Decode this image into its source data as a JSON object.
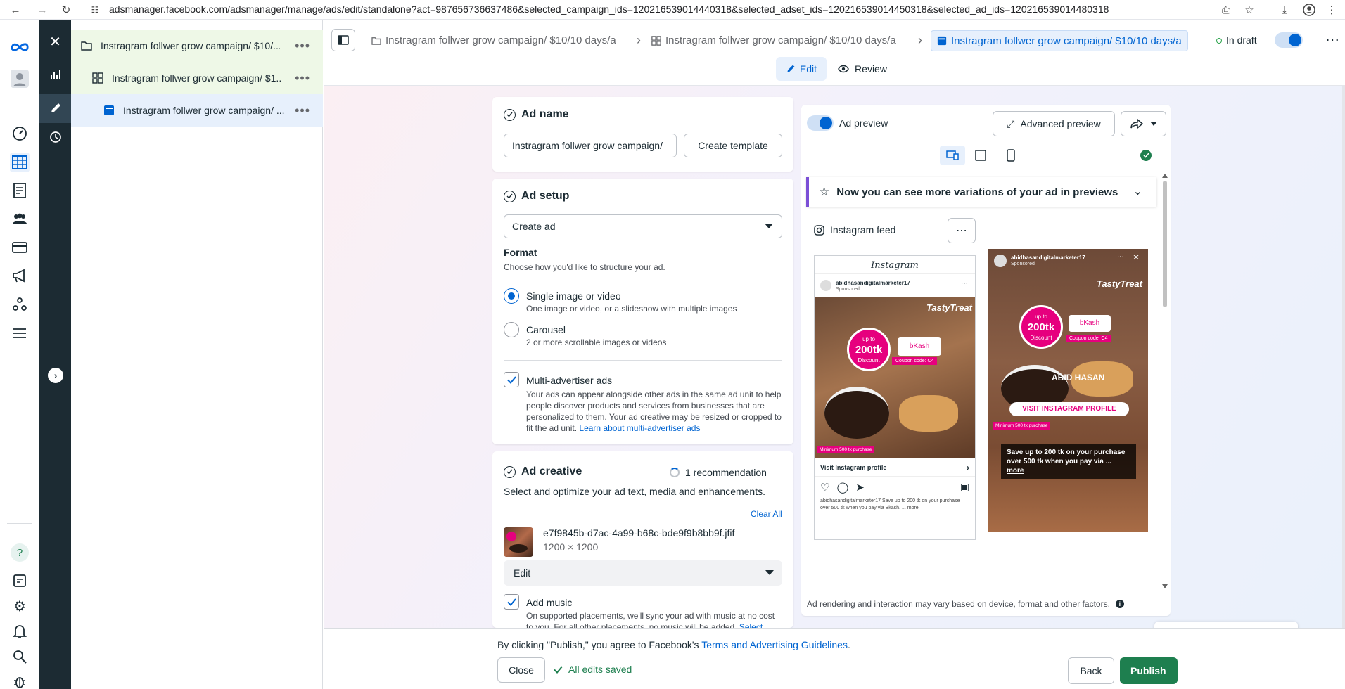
{
  "browser": {
    "url": "adsmanager.facebook.com/adsmanager/manage/ads/edit/standalone?act=987656736637486&selected_campaign_ids=120216539014440318&selected_adset_ids=120216539014450318&selected_ad_ids=120216539014480318"
  },
  "tree": {
    "campaign": "Instragram follwer grow campaign/ $10/...",
    "adset": "Instragram follwer grow campaign/ $1...",
    "ad": "Instragram follwer grow campaign/ ..."
  },
  "header": {
    "crumb_campaign": "Instragram follwer grow campaign/ $10/10 days/a",
    "crumb_adset": "Instragram follwer grow campaign/ $10/10 days/a",
    "crumb_ad": "Instragram follwer grow campaign/ $10/10 days/a",
    "status": "In draft",
    "tab_edit": "Edit",
    "tab_review": "Review"
  },
  "ad_name": {
    "title": "Ad name",
    "value": "Instragram follwer grow campaign/",
    "create_template": "Create template"
  },
  "ad_setup": {
    "title": "Ad setup",
    "select_value": "Create ad",
    "format_title": "Format",
    "format_desc": "Choose how you'd like to structure your ad.",
    "opt1_label": "Single image or video",
    "opt1_desc": "One image or video, or a slideshow with multiple images",
    "opt2_label": "Carousel",
    "opt2_desc": "2 or more scrollable images or videos",
    "multi_label": "Multi-advertiser ads",
    "multi_desc": "Your ads can appear alongside other ads in the same ad unit to help people discover products and services from businesses that are personalized to them. Your ad creative may be resized or cropped to fit the ad unit.",
    "multi_link": "Learn about multi-advertiser ads"
  },
  "ad_creative": {
    "title": "Ad creative",
    "recommendation": "1 recommendation",
    "desc": "Select and optimize your ad text, media and enhancements.",
    "clear_all": "Clear All",
    "file_name": "e7f9845b-d7ac-4a99-b68c-bde9f9b8bb9f.jfif",
    "file_size": "1200 × 1200",
    "edit_select": "Edit",
    "music_label": "Add music",
    "music_desc": "On supported placements, we'll sync your ad with music at no cost to you. For all other placements, no music will be added.",
    "music_link": "Select"
  },
  "preview": {
    "toggle_label": "Ad preview",
    "advanced": "Advanced preview",
    "banner": "Now you can see more variations of your ad in previews",
    "placement": "Instagram feed",
    "ig_brand": "Instagram",
    "account": "abidhasandigitalmarketer17",
    "sponsored": "Sponsored",
    "brand": "TastyTreat",
    "offer_top": "up to",
    "offer_amount": "200tk",
    "offer_bottom": "Discount",
    "pay": "bKash",
    "coupon": "Coupon code: C4",
    "minimum": "Minimum 500 tk purchase",
    "cta": "Visit Instagram profile",
    "caption": "abidhasandigitalmarketer17 Save up to 200 tk on your purchase over 500 tk when you pay via Bkash. ... more",
    "story_name": "ABID HASAN",
    "story_cta": "VISIT INSTAGRAM PROFILE",
    "story_caption": "Save up to 200 tk on your purchase over 500 tk when you pay via ...",
    "story_more": "more",
    "disclaimer": "Ad rendering and interaction may vary based on device, format and other factors."
  },
  "footer": {
    "terms_prefix": "By clicking \"Publish,\" you agree to Facebook's",
    "terms_link": "Terms and Advertising Guidelines",
    "close": "Close",
    "saved": "All edits saved",
    "back": "Back",
    "publish": "Publish"
  },
  "colors": {
    "brand_blue": "#0064d1",
    "publish_green": "#1e7f4f",
    "tree_dark": "#1c2b33"
  }
}
